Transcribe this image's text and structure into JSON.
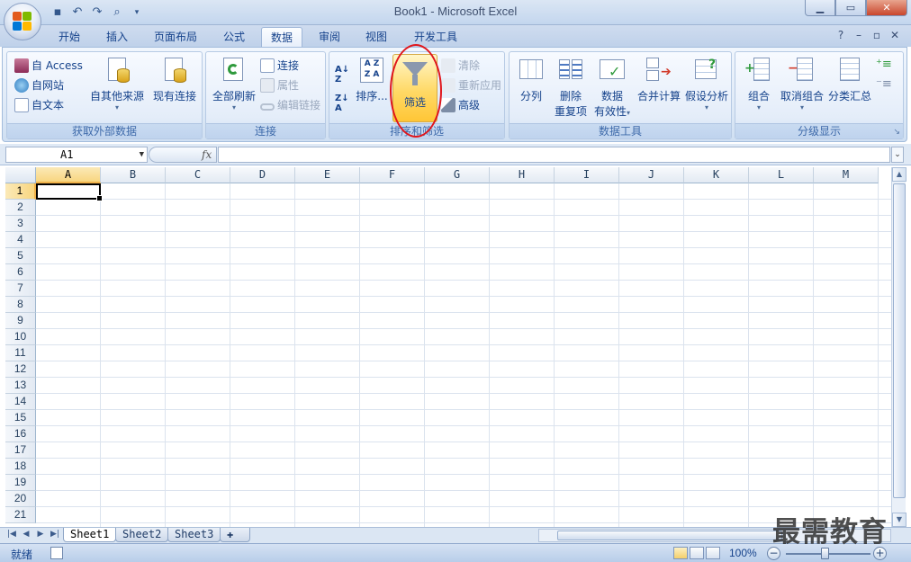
{
  "window": {
    "title": "Book1 - Microsoft Excel",
    "controls": {
      "minimize": "▁",
      "maximize": "▭",
      "close": "✕"
    }
  },
  "quick_access": {
    "icons": [
      "save-icon",
      "undo-icon",
      "redo-icon",
      "print-preview-icon",
      "customize-qat-icon"
    ]
  },
  "tabs": [
    {
      "label": "开始",
      "active": false
    },
    {
      "label": "插入",
      "active": false
    },
    {
      "label": "页面布局",
      "active": false
    },
    {
      "label": "公式",
      "active": false
    },
    {
      "label": "数据",
      "active": true
    },
    {
      "label": "审阅",
      "active": false
    },
    {
      "label": "视图",
      "active": false
    },
    {
      "label": "开发工具",
      "active": false
    }
  ],
  "ribbon": {
    "external_data": {
      "label": "获取外部数据",
      "from_access": "自 Access",
      "from_web": "自网站",
      "from_text": "自文本",
      "from_other": "自其他来源",
      "existing": "现有连接"
    },
    "connections": {
      "label": "连接",
      "refresh_all": "全部刷新",
      "connections": "连接",
      "properties": "属性",
      "edit_links": "编辑链接"
    },
    "sort_filter": {
      "label": "排序和筛选",
      "sort": "排序...",
      "filter": "筛选",
      "clear": "清除",
      "reapply": "重新应用",
      "advanced": "高级"
    },
    "data_tools": {
      "label": "数据工具",
      "text_to_columns": "分列",
      "remove_dup_1": "删除",
      "remove_dup_2": "重复项",
      "validation_1": "数据",
      "validation_2": "有效性",
      "consolidate": "合并计算",
      "what_if": "假设分析"
    },
    "outline": {
      "label": "分级显示",
      "group": "组合",
      "ungroup": "取消组合",
      "subtotal": "分类汇总"
    }
  },
  "formula_bar": {
    "name_box": "A1",
    "fx": "fx",
    "formula": ""
  },
  "grid": {
    "columns": [
      "A",
      "B",
      "C",
      "D",
      "E",
      "F",
      "G",
      "H",
      "I",
      "J",
      "K",
      "L",
      "M"
    ],
    "rows": [
      "1",
      "2",
      "3",
      "4",
      "5",
      "6",
      "7",
      "8",
      "9",
      "10",
      "11",
      "12",
      "13",
      "14",
      "15",
      "16",
      "17",
      "18",
      "19",
      "20",
      "21"
    ],
    "active_cell": "A1"
  },
  "sheets": [
    {
      "label": "Sheet1",
      "active": true
    },
    {
      "label": "Sheet2",
      "active": false
    },
    {
      "label": "Sheet3",
      "active": false
    }
  ],
  "status": {
    "ready": "就绪",
    "zoom": "100%",
    "zoom_out": "−",
    "zoom_in": "+"
  },
  "watermark": "最需教育",
  "colors": {
    "accent_text": "#15428b",
    "selection_highlight": "#f8d680",
    "filter_button": "#ffd966",
    "annotation_ring": "#e0151b"
  }
}
